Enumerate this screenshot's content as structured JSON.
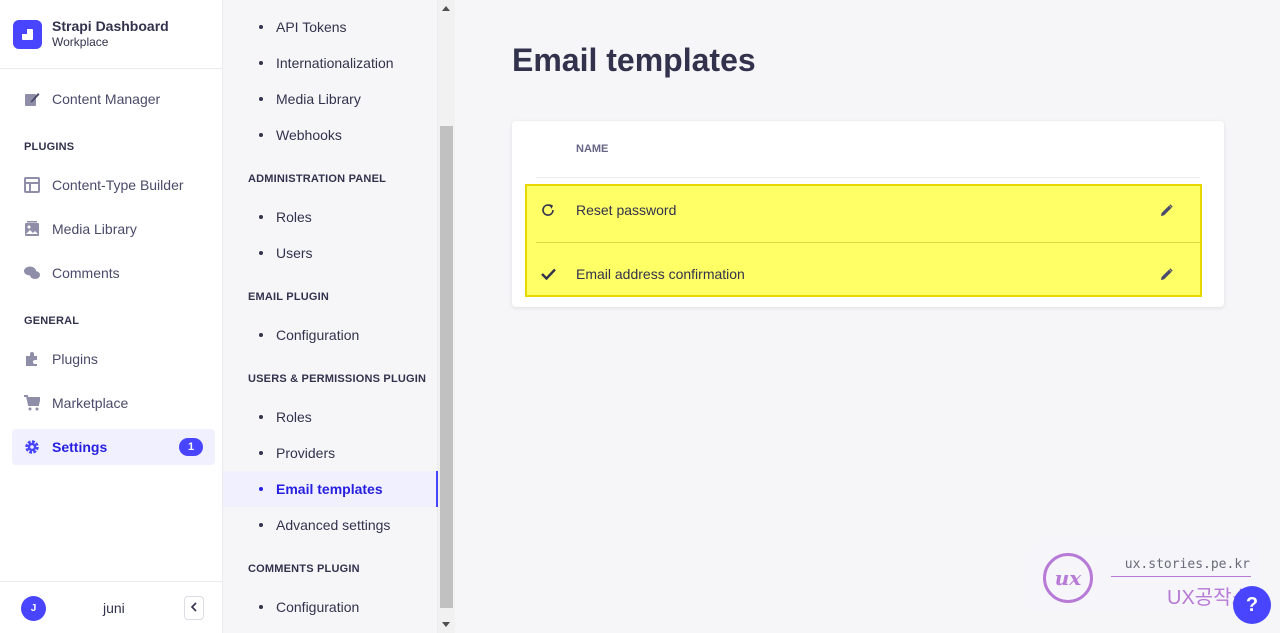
{
  "brand": {
    "title": "Strapi Dashboard",
    "subtitle": "Workplace"
  },
  "mainnav": {
    "content_manager": "Content Manager",
    "plugins_section": "PLUGINS",
    "content_type_builder": "Content-Type Builder",
    "media_library": "Media Library",
    "comments": "Comments",
    "general_section": "GENERAL",
    "plugins": "Plugins",
    "marketplace": "Marketplace",
    "settings": "Settings",
    "settings_badge": "1"
  },
  "user": {
    "initial": "J",
    "name": "juni"
  },
  "subnav": {
    "api_tokens": "API Tokens",
    "internationalization": "Internationalization",
    "media_library": "Media Library",
    "webhooks": "Webhooks",
    "admin_section": "ADMINISTRATION PANEL",
    "admin_roles": "Roles",
    "admin_users": "Users",
    "email_section": "EMAIL PLUGIN",
    "email_configuration": "Configuration",
    "up_section": "USERS & PERMISSIONS PLUGIN",
    "up_roles": "Roles",
    "up_providers": "Providers",
    "up_email_templates": "Email templates",
    "up_advanced_settings": "Advanced settings",
    "comments_section": "COMMENTS PLUGIN",
    "comments_configuration": "Configuration"
  },
  "main": {
    "title": "Email templates",
    "table_header_name": "NAME",
    "rows": [
      {
        "name": "Reset password",
        "icon": "refresh-icon"
      },
      {
        "name": "Email address confirmation",
        "icon": "check-icon"
      }
    ]
  },
  "watermark": {
    "url": "ux.stories.pe.kr",
    "name": "UX공작소",
    "logo": "ux"
  },
  "help": {
    "label": "?"
  },
  "colors": {
    "accent": "#4945ff",
    "highlight": "#ffff66"
  }
}
